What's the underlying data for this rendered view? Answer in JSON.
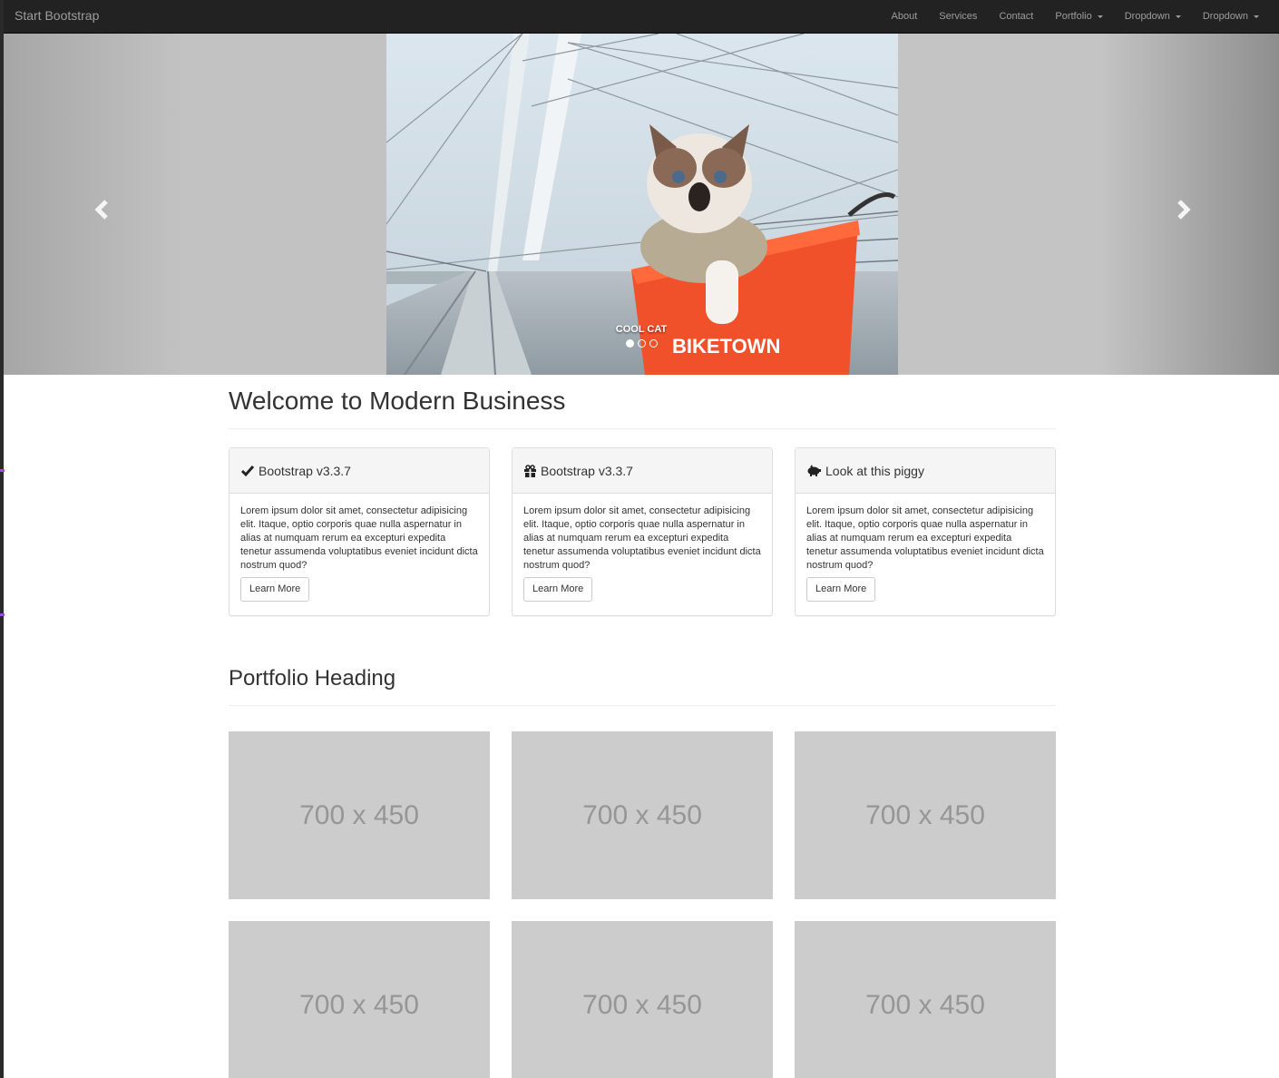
{
  "navbar": {
    "brand": "Start Bootstrap",
    "items": [
      {
        "label": "About"
      },
      {
        "label": "Services"
      },
      {
        "label": "Contact"
      },
      {
        "label": "Portfolio"
      },
      {
        "label": "Dropdown"
      },
      {
        "label": "Dropdown"
      }
    ]
  },
  "carousel": {
    "caption": "COOL CAT",
    "photo_text": "BIKETOWN",
    "slides": 3,
    "active_slide": 1
  },
  "main": {
    "heading": "Welcome to Modern Business",
    "panels": [
      {
        "icon": "checkmark-icon",
        "title": "Bootstrap v3.3.7",
        "body": "Lorem ipsum dolor sit amet, consectetur adipisicing elit. Itaque, optio corporis quae nulla aspernatur in alias at numquam rerum ea excepturi expedita tenetur assumenda voluptatibus eveniet incidunt dicta nostrum quod?",
        "button": "Learn More"
      },
      {
        "icon": "gift-icon",
        "title": "Bootstrap v3.3.7",
        "body": "Lorem ipsum dolor sit amet, consectetur adipisicing elit. Itaque, optio corporis quae nulla aspernatur in alias at numquam rerum ea excepturi expedita tenetur assumenda voluptatibus eveniet incidunt dicta nostrum quod?",
        "button": "Learn More"
      },
      {
        "icon": "piggy-bank-icon",
        "title": "Look at this piggy",
        "body": "Lorem ipsum dolor sit amet, consectetur adipisicing elit. Itaque, optio corporis quae nulla aspernatur in alias at numquam rerum ea excepturi expedita tenetur assumenda voluptatibus eveniet incidunt dicta nostrum quod?",
        "button": "Learn More"
      }
    ]
  },
  "portfolio": {
    "heading": "Portfolio Heading",
    "items": [
      {
        "label": "700 x 450"
      },
      {
        "label": "700 x 450"
      },
      {
        "label": "700 x 450"
      },
      {
        "label": "700 x 450"
      },
      {
        "label": "700 x 450"
      },
      {
        "label": "700 x 450"
      }
    ]
  },
  "colors": {
    "navbar_bg": "#222222",
    "nav_text": "#9d9d9d",
    "placeholder_bg": "#cccccc",
    "basket": "#f0502a"
  }
}
